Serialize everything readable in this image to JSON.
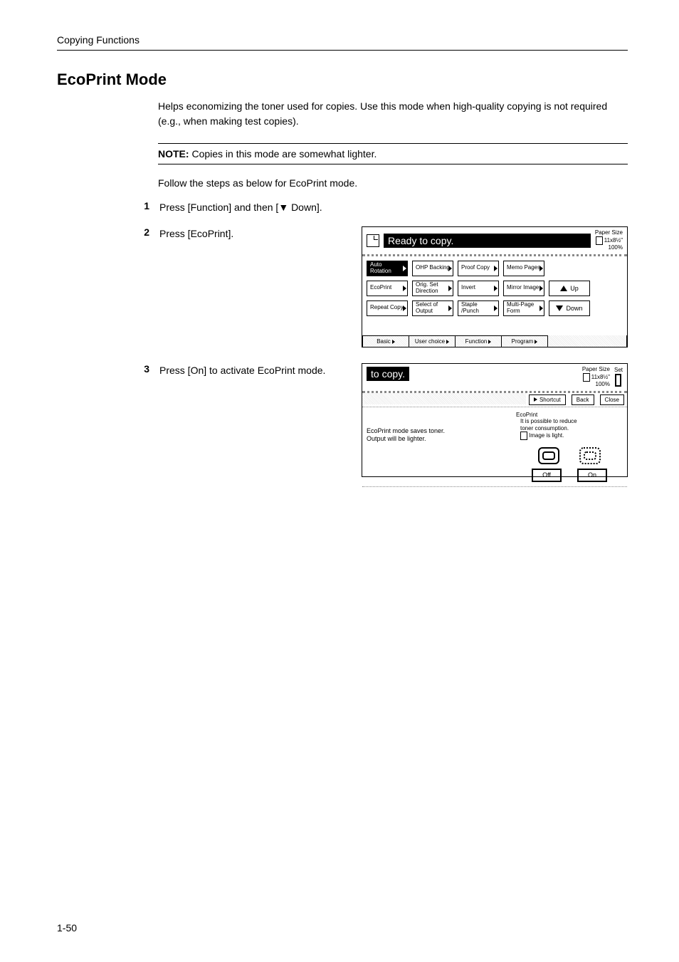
{
  "header": {
    "running_head": "Copying Functions"
  },
  "title": "EcoPrint Mode",
  "intro": "Helps economizing the toner used for copies. Use this mode when high-quality copying is not required (e.g., when making test copies).",
  "note": {
    "label": "NOTE:",
    "text": "Copies in this mode are somewhat lighter."
  },
  "follow": "Follow the steps as below for EcoPrint mode.",
  "steps": {
    "s1": {
      "num": "1",
      "text": "Press [Function] and then [▼ Down]."
    },
    "s2": {
      "num": "2",
      "text": "Press [EcoPrint]."
    },
    "s3": {
      "num": "3",
      "text": "Press [On] to activate EcoPrint mode."
    }
  },
  "fig1": {
    "ready": "Ready to copy.",
    "papersize_label": "Paper Size",
    "papersize_value": "11x8½\"",
    "zoom": "100%",
    "buttons": {
      "r1": [
        "Auto Rotation",
        "OHP Backing",
        "Proof Copy",
        "Memo Pages"
      ],
      "r2": [
        "EcoPrint",
        "Orig. Set Direction",
        "Invert",
        "Mirror Image"
      ],
      "r3": [
        "Repeat Copy",
        "Select of Output",
        "Staple /Punch",
        "Multi-Page Form"
      ]
    },
    "nav": {
      "up": "Up",
      "down": "Down"
    },
    "tabs": [
      "Basic",
      "User choice",
      "Function",
      "Program"
    ]
  },
  "fig2": {
    "tocopy": "to copy.",
    "papersize_label": "Paper Size",
    "papersize_value": "11x8½\"",
    "zoom": "100%",
    "set": "Set",
    "toolbar": {
      "shortcut": "Shortcut",
      "back": "Back",
      "close": "Close"
    },
    "left": {
      "l1": "EcoPrint mode saves toner.",
      "l2": "Output will be lighter."
    },
    "right": {
      "heading": "EcoPrint",
      "line1": "It is possible to reduce",
      "line2": "toner consumption.",
      "line3": "Image is light."
    },
    "off": "Off",
    "on": "On"
  },
  "page_number": "1-50"
}
